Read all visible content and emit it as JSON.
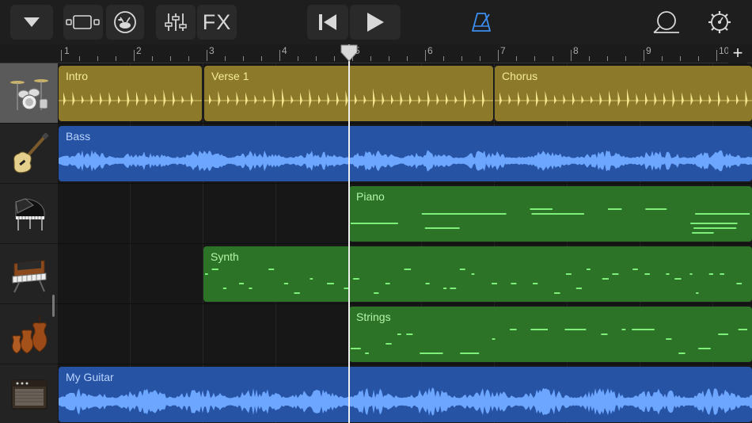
{
  "toolbar": {
    "fx_label": "FX"
  },
  "ruler": {
    "bars": [
      "1",
      "2",
      "3",
      "4",
      "5",
      "6",
      "7",
      "8",
      "9",
      "10"
    ]
  },
  "tracks": [
    {
      "instrument": "drum-kit",
      "regions": [
        {
          "label": "Intro"
        },
        {
          "label": "Verse 1"
        },
        {
          "label": "Chorus"
        }
      ]
    },
    {
      "instrument": "bass-guitar",
      "regions": [
        {
          "label": "Bass"
        }
      ]
    },
    {
      "instrument": "grand-piano",
      "regions": [
        {
          "label": "Piano"
        }
      ]
    },
    {
      "instrument": "synthesizer",
      "regions": [
        {
          "label": "Synth"
        }
      ]
    },
    {
      "instrument": "strings",
      "regions": [
        {
          "label": "Strings"
        }
      ]
    },
    {
      "instrument": "guitar-amp",
      "regions": [
        {
          "label": "My Guitar"
        }
      ]
    }
  ],
  "colors": {
    "drums": "#8c7a2a",
    "audio": "#2653a4",
    "midi": "#2d7327",
    "metronome_active": "#3d8ef0"
  }
}
